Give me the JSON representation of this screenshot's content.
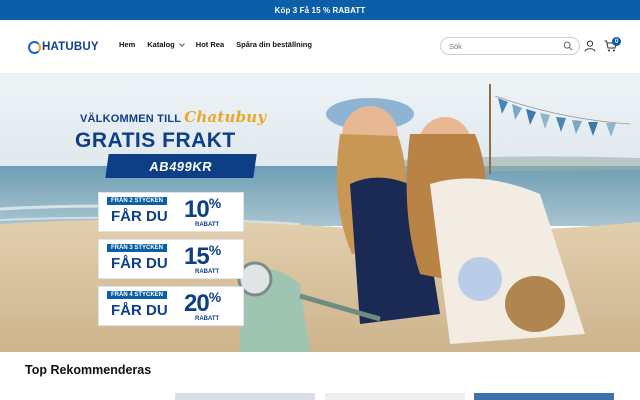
{
  "announcement": "Köp 3 Få 15 % RABATT",
  "brand": {
    "logo_text": "HATUBUY",
    "logo_accent": "#f0a21b",
    "brand_color": "#0f3e8c"
  },
  "nav": {
    "items": [
      {
        "label": "Hem",
        "has_dropdown": false
      },
      {
        "label": "Katalog",
        "has_dropdown": true
      },
      {
        "label": "Hot Rea",
        "has_dropdown": false
      },
      {
        "label": "Spåra din beställning",
        "has_dropdown": false
      }
    ]
  },
  "search": {
    "placeholder": "Sök",
    "value": "",
    "icon": "search-icon"
  },
  "header_icons": {
    "account": "user-icon",
    "cart": "cart-icon"
  },
  "cart": {
    "count": "0"
  },
  "hero": {
    "welcome": "VÄLKOMMEN TILL",
    "welcome_script": "Chatubuy",
    "headline": "GRATIS FRAKT",
    "code": "AB499KR",
    "offers": [
      {
        "tag": "FRÅN 2 STYCKEN",
        "far": "FÅR DU",
        "percent": "10",
        "unit": "%",
        "rabatt": "RABATT"
      },
      {
        "tag": "FRÅN 3 STYCKEN",
        "far": "FÅR DU",
        "percent": "15",
        "unit": "%",
        "rabatt": "RABATT"
      },
      {
        "tag": "FRÅN 4 STYCKEN",
        "far": "FÅR DU",
        "percent": "20",
        "unit": "%",
        "rabatt": "RABATT"
      }
    ],
    "colors": {
      "primary": "#0c3f86",
      "accent": "#0b5ea8"
    }
  },
  "section": {
    "title": "Top Rekommenderas"
  }
}
